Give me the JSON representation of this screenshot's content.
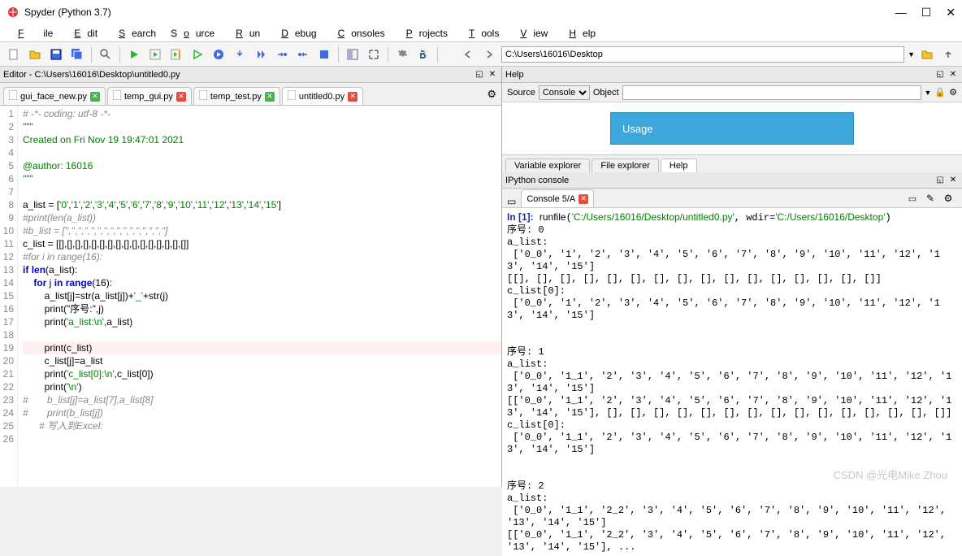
{
  "window": {
    "title": "Spyder (Python 3.7)"
  },
  "menu": {
    "file": "File",
    "edit": "Edit",
    "search": "Search",
    "source": "Source",
    "run": "Run",
    "debug": "Debug",
    "consoles": "Consoles",
    "projects": "Projects",
    "tools": "Tools",
    "view": "View",
    "help": "Help"
  },
  "toolbar": {
    "path_value": "C:\\Users\\16016\\Desktop"
  },
  "editor": {
    "header": "Editor - C:\\Users\\16016\\Desktop\\untitled0.py",
    "tabs": [
      {
        "label": "gui_face_new.py",
        "dirty": false
      },
      {
        "label": "temp_gui.py",
        "dirty": true
      },
      {
        "label": "temp_test.py",
        "dirty": false
      },
      {
        "label": "untitled0.py",
        "dirty": true,
        "active": true
      }
    ],
    "lines": [
      {
        "n": 1,
        "type": "c",
        "text": "# -*- coding: utf-8 -*-"
      },
      {
        "n": 2,
        "type": "s",
        "text": "\"\"\""
      },
      {
        "n": 3,
        "type": "s",
        "text": "Created on Fri Nov 19 19:47:01 2021"
      },
      {
        "n": 4,
        "type": "s",
        "text": ""
      },
      {
        "n": 5,
        "type": "s",
        "text": "@author: 16016"
      },
      {
        "n": 6,
        "type": "s",
        "text": "\"\"\""
      },
      {
        "n": 7,
        "type": "n",
        "text": ""
      },
      {
        "n": 8,
        "type": "mix",
        "text": "a_list = ['0','1','2','3','4','5','6','7','8','9','10','11','12','13','14','15']"
      },
      {
        "n": 9,
        "type": "c",
        "text": "#print(len(a_list))"
      },
      {
        "n": 10,
        "type": "c",
        "text": "#b_list = ['','','','','','','','','','','','','','','','']"
      },
      {
        "n": 11,
        "type": "mix",
        "text": "c_list = [[],[],[],[],[],[],[],[],[],[],[],[],[],[],[],[]]"
      },
      {
        "n": 12,
        "type": "c",
        "text": "#for i in range(16):"
      },
      {
        "n": 13,
        "type": "k",
        "text": "if len(a_list):"
      },
      {
        "n": 14,
        "type": "k",
        "text": "    for j in range(16):"
      },
      {
        "n": 15,
        "type": "mix",
        "text": "        a_list[j]=str(a_list[j])+'_'+str(j)"
      },
      {
        "n": 16,
        "type": "mix",
        "text": "        print(\"序号:\",j)"
      },
      {
        "n": 17,
        "type": "mix",
        "text": "        print('a_list:\\n',a_list)"
      },
      {
        "n": 18,
        "type": "n",
        "text": ""
      },
      {
        "n": 19,
        "type": "hl",
        "text": "        print(c_list)"
      },
      {
        "n": 20,
        "type": "mix",
        "text": "        c_list[j]=a_list"
      },
      {
        "n": 21,
        "type": "mix",
        "text": "        print('c_list[0]:\\n',c_list[0])"
      },
      {
        "n": 22,
        "type": "mix",
        "text": "        print('\\n')"
      },
      {
        "n": 23,
        "type": "c",
        "text": "#       b_list[j]=a_list[7],a_list[8]"
      },
      {
        "n": 24,
        "type": "c",
        "text": "#       print(b_list[j])"
      },
      {
        "n": 25,
        "type": "c",
        "text": "      # 写入到Excel:"
      },
      {
        "n": 26,
        "type": "n",
        "text": ""
      }
    ]
  },
  "help": {
    "header": "Help",
    "source_label": "Source",
    "source_value": "Console",
    "object_label": "Object",
    "object_value": "",
    "usage_title": "Usage",
    "subtabs": [
      "Variable explorer",
      "File explorer",
      "Help"
    ],
    "active_subtab": 2
  },
  "ipython": {
    "header": "IPython console",
    "tab_label": "Console 5/A",
    "output": "In [1]: runfile('C:/Users/16016/Desktop/untitled0.py', wdir='C:/Users/16016/Desktop')\n序号: 0\na_list:\n ['0_0', '1', '2', '3', '4', '5', '6', '7', '8', '9', '10', '11', '12', '13', '14', '15']\n[[], [], [], [], [], [], [], [], [], [], [], [], [], [], [], []]\nc_list[0]:\n ['0_0', '1', '2', '3', '4', '5', '6', '7', '8', '9', '10', '11', '12', '13', '14', '15']\n\n\n序号: 1\na_list:\n ['0_0', '1_1', '2', '3', '4', '5', '6', '7', '8', '9', '10', '11', '12', '13', '14', '15']\n[['0_0', '1_1', '2', '3', '4', '5', '6', '7', '8', '9', '10', '11', '12', '13', '14', '15'], [], [], [], [], [], [], [], [], [], [], [], [], [], [], []]\nc_list[0]:\n ['0_0', '1_1', '2', '3', '4', '5', '6', '7', '8', '9', '10', '11', '12', '13', '14', '15']\n\n\n序号: 2\na_list:\n ['0_0', '1_1', '2_2', '3', '4', '5', '6', '7', '8', '9', '10', '11', '12', '13', '14', '15']\n[['0_0', '1_1', '2_2', '3', '4', '5', '6', '7', '8', '9', '10', '11', '12', '13', '14', '15'], ..."
  },
  "watermark": "CSDN @光电Mike Zhou"
}
